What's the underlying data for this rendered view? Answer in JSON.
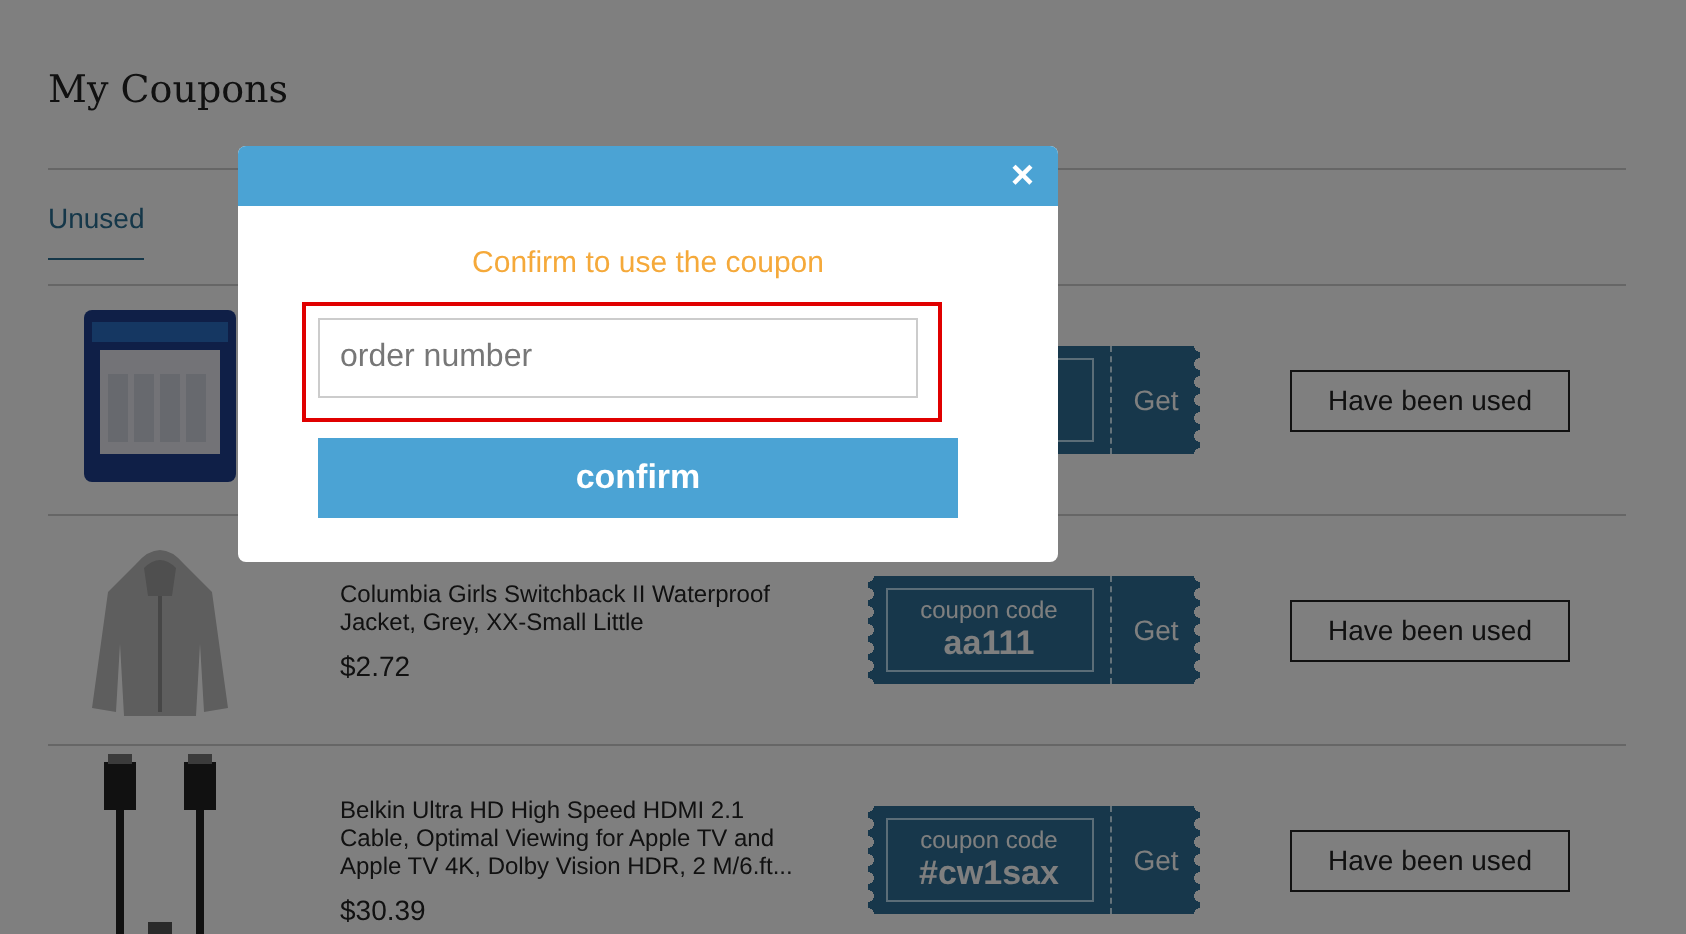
{
  "page": {
    "title": "My Coupons"
  },
  "tabs": [
    {
      "label": "Unused",
      "selected": true
    }
  ],
  "coupons": [
    {
      "get_label": "Get",
      "status": "Have been used"
    },
    {
      "name": "Columbia Girls Switchback II Waterproof Jacket, Grey, XX-Small Little",
      "price": "$2.72",
      "code_label": "coupon code",
      "code": "aa111",
      "get_label": "Get",
      "status": "Have been used"
    },
    {
      "name": "Belkin Ultra HD High Speed HDMI 2.1 Cable, Optimal Viewing for Apple TV and Apple TV 4K, Dolby Vision HDR, 2 M/6.ft...",
      "price": "$30.39",
      "code_label": "coupon code",
      "code": "#cw1sax",
      "get_label": "Get",
      "status": "Have been used"
    }
  ],
  "modal": {
    "close": "×",
    "title": "Confirm to use the coupon",
    "input": {
      "placeholder": "order number",
      "highlighted": true
    },
    "button": "confirm"
  }
}
